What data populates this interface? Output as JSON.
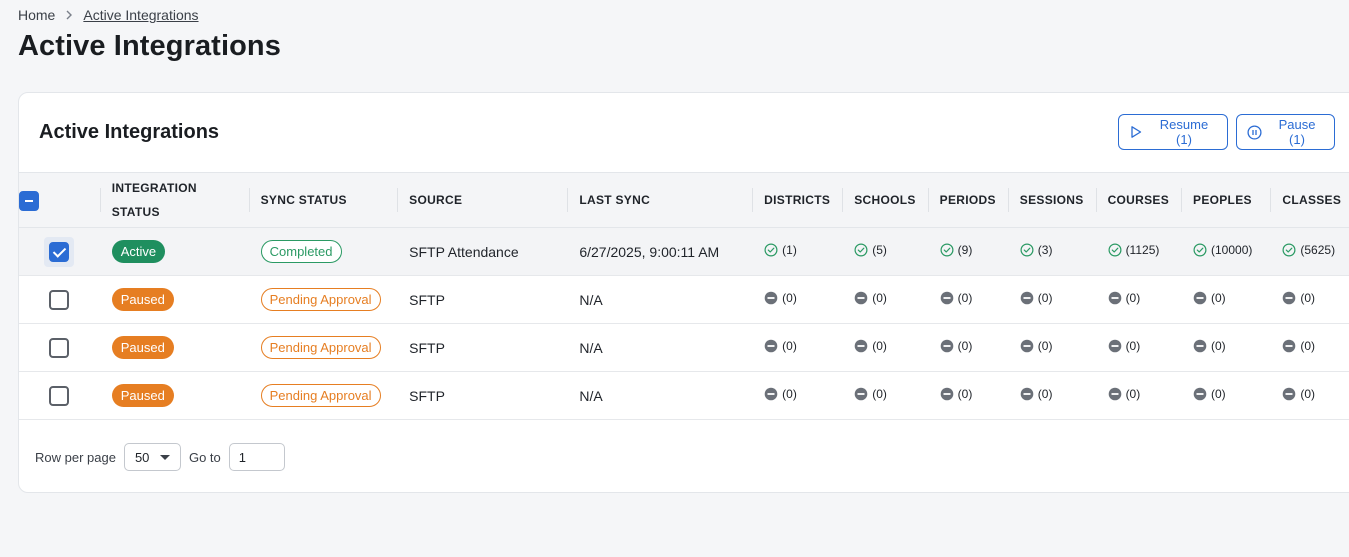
{
  "breadcrumb": {
    "home": "Home",
    "current": "Active Integrations"
  },
  "page_title": "Active Integrations",
  "card": {
    "title": "Active Integrations",
    "resume_label": "Resume (1)",
    "pause_label": "Pause (1)"
  },
  "columns": {
    "integration_status_1": "INTEGRATION",
    "integration_status_2": "STATUS",
    "sync_status": "SYNC STATUS",
    "source": "SOURCE",
    "last_sync": "LAST SYNC",
    "districts": "DISTRICTS",
    "schools": "SCHOOLS",
    "periods": "PERIODS",
    "sessions": "SESSIONS",
    "courses": "COURSES",
    "peoples": "PEOPLES",
    "classes": "CLASSES"
  },
  "rows": [
    {
      "selected": true,
      "status": "Active",
      "sync_status": "Completed",
      "source": "SFTP Attendance",
      "last_sync": "6/27/2025, 9:00:11 AM",
      "districts": "(1)",
      "schools": "(5)",
      "periods": "(9)",
      "sessions": "(3)",
      "courses": "(1125)",
      "peoples": "(10000)",
      "classes": "(5625)"
    },
    {
      "selected": false,
      "status": "Paused",
      "sync_status": "Pending Approval",
      "source": "SFTP",
      "last_sync": "N/A",
      "districts": "(0)",
      "schools": "(0)",
      "periods": "(0)",
      "sessions": "(0)",
      "courses": "(0)",
      "peoples": "(0)",
      "classes": "(0)"
    },
    {
      "selected": false,
      "status": "Paused",
      "sync_status": "Pending Approval",
      "source": "SFTP",
      "last_sync": "N/A",
      "districts": "(0)",
      "schools": "(0)",
      "periods": "(0)",
      "sessions": "(0)",
      "courses": "(0)",
      "peoples": "(0)",
      "classes": "(0)"
    },
    {
      "selected": false,
      "status": "Paused",
      "sync_status": "Pending Approval",
      "source": "SFTP",
      "last_sync": "N/A",
      "districts": "(0)",
      "schools": "(0)",
      "periods": "(0)",
      "sessions": "(0)",
      "courses": "(0)",
      "peoples": "(0)",
      "classes": "(0)"
    }
  ],
  "footer": {
    "rows_label": "Row per page",
    "rows_value": "50",
    "goto_label": "Go to",
    "goto_value": "1"
  },
  "icons": {
    "check": "check-circle-icon",
    "none": "minus-circle-icon",
    "resume": "play-icon",
    "pause": "pause-icon",
    "chevron": "chevron-right-icon"
  },
  "colors": {
    "accent": "#2b6cd4",
    "active": "#1f8f5f",
    "paused": "#e67e22",
    "completed": "#2b9a64"
  }
}
